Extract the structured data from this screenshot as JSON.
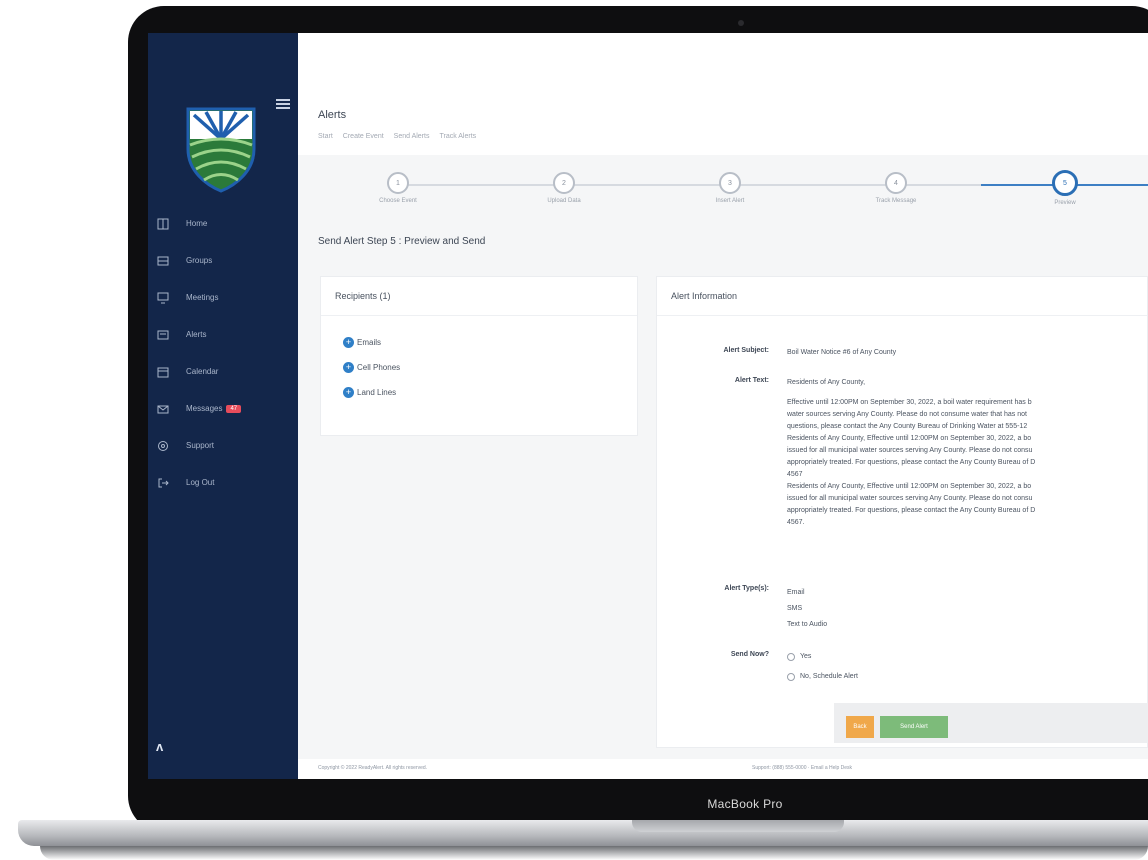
{
  "device": {
    "model_label": "MacBook Pro"
  },
  "sidebar": {
    "items": [
      {
        "label": "Home",
        "icon": "dashboard-icon"
      },
      {
        "label": "Groups",
        "icon": "groups-icon"
      },
      {
        "label": "Meetings",
        "icon": "monitor-icon"
      },
      {
        "label": "Alerts",
        "icon": "alert-icon"
      },
      {
        "label": "Calendar",
        "icon": "calendar-icon"
      },
      {
        "label": "Messages",
        "icon": "mail-icon",
        "badge": "47"
      },
      {
        "label": "Support",
        "icon": "support-icon"
      },
      {
        "label": "Log Out",
        "icon": "logout-icon"
      }
    ],
    "footer_logo": "ᴧ",
    "colors": {
      "background": "#13264a",
      "logo_green": "#2d8a3c",
      "logo_blue": "#1f5fae"
    }
  },
  "header": {
    "title": "Alerts",
    "breadcrumbs": [
      "Start",
      "Create Event",
      "Send Alerts",
      "Track Alerts"
    ]
  },
  "stepper": {
    "steps": [
      {
        "number": "1",
        "label": "Choose Event"
      },
      {
        "number": "2",
        "label": "Upload Data"
      },
      {
        "number": "3",
        "label": "Insert Alert"
      },
      {
        "number": "4",
        "label": "Track Message"
      },
      {
        "number": "5",
        "label": "Preview"
      }
    ],
    "active_step": 5
  },
  "step_heading": "Send Alert Step 5 : Preview and Send",
  "recipients": {
    "title": "Recipients (1)",
    "items": [
      "Emails",
      "Cell Phones",
      "Land Lines"
    ]
  },
  "alert_info": {
    "title": "Alert Information",
    "subject_label": "Alert Subject:",
    "subject": "Boil Water Notice #6 of Any County",
    "text_label": "Alert Text:",
    "text_lines": [
      "Residents of Any County,",
      "Effective until 12:00PM on September 30, 2022, a boil water requirement has b",
      "water sources serving Any County. Please do not consume water that has not",
      "questions, please contact the Any County Bureau of Drinking Water at 555-12",
      "Residents of Any County, Effective until 12:00PM on September 30, 2022, a bo",
      "issued for all municipal water sources serving Any County. Please do not consu",
      "appropriately treated. For questions, please contact the Any County Bureau of D",
      "4567",
      "Residents of Any County, Effective until 12:00PM on September 30, 2022, a bo",
      "issued for all municipal water sources serving Any County. Please do not consu",
      "appropriately treated. For questions, please contact the Any County Bureau of D",
      "4567."
    ],
    "types_label": "Alert Type(s):",
    "types": [
      "Email",
      "SMS",
      "Text to Audio"
    ],
    "send_now_label": "Send Now?",
    "send_now_options": [
      "Yes",
      "No, Schedule Alert"
    ]
  },
  "actions": {
    "back_label": "Back",
    "send_label": "Send Alert"
  },
  "footer": {
    "copyright": "Copyright © 2022 ReadyAlert. All rights reserved.",
    "support": "Support: (888) 555-0000 · Email a Help Desk"
  }
}
